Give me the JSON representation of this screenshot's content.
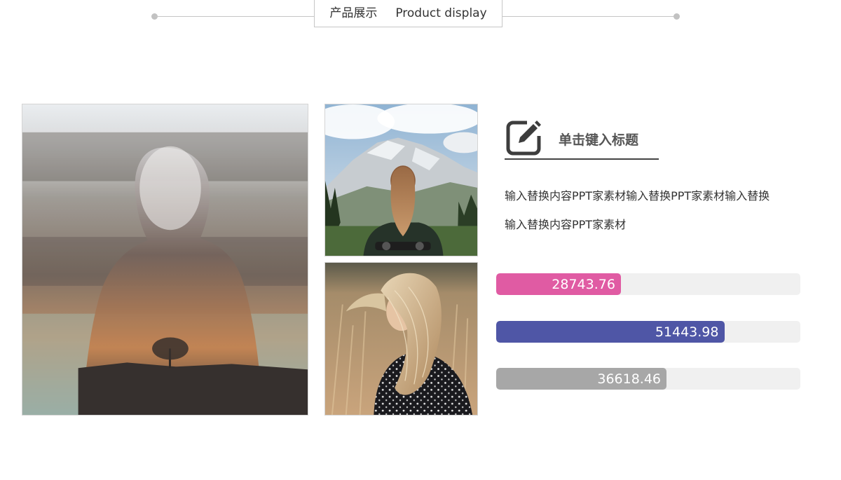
{
  "header": {
    "title_cn": "产品展示",
    "title_en": "Product display"
  },
  "photos": [
    {
      "name": "double-exposure-silhouette-photo"
    },
    {
      "name": "woman-facing-mountains-photo"
    },
    {
      "name": "woman-hair-wind-field-photo"
    }
  ],
  "feature": {
    "icon": "edit-icon",
    "title": "单击键入标题",
    "lines": [
      "输入替换内容PPT家素材输入替换PPT家素材输入替换",
      "输入替换内容PPT家素材"
    ]
  },
  "bars": [
    {
      "label": "28743.76",
      "fill_fraction": 0.41,
      "color": "#e05ba3"
    },
    {
      "label": "51443.98",
      "fill_fraction": 0.75,
      "color": "#4f56a6"
    },
    {
      "label": "36618.46",
      "fill_fraction": 0.56,
      "color": "#a7a7a7"
    }
  ],
  "colors": {
    "accent_pink": "#e05ba3",
    "accent_blue": "#4f56a6",
    "accent_gray": "#a7a7a7",
    "track": "#f0f0f0"
  }
}
